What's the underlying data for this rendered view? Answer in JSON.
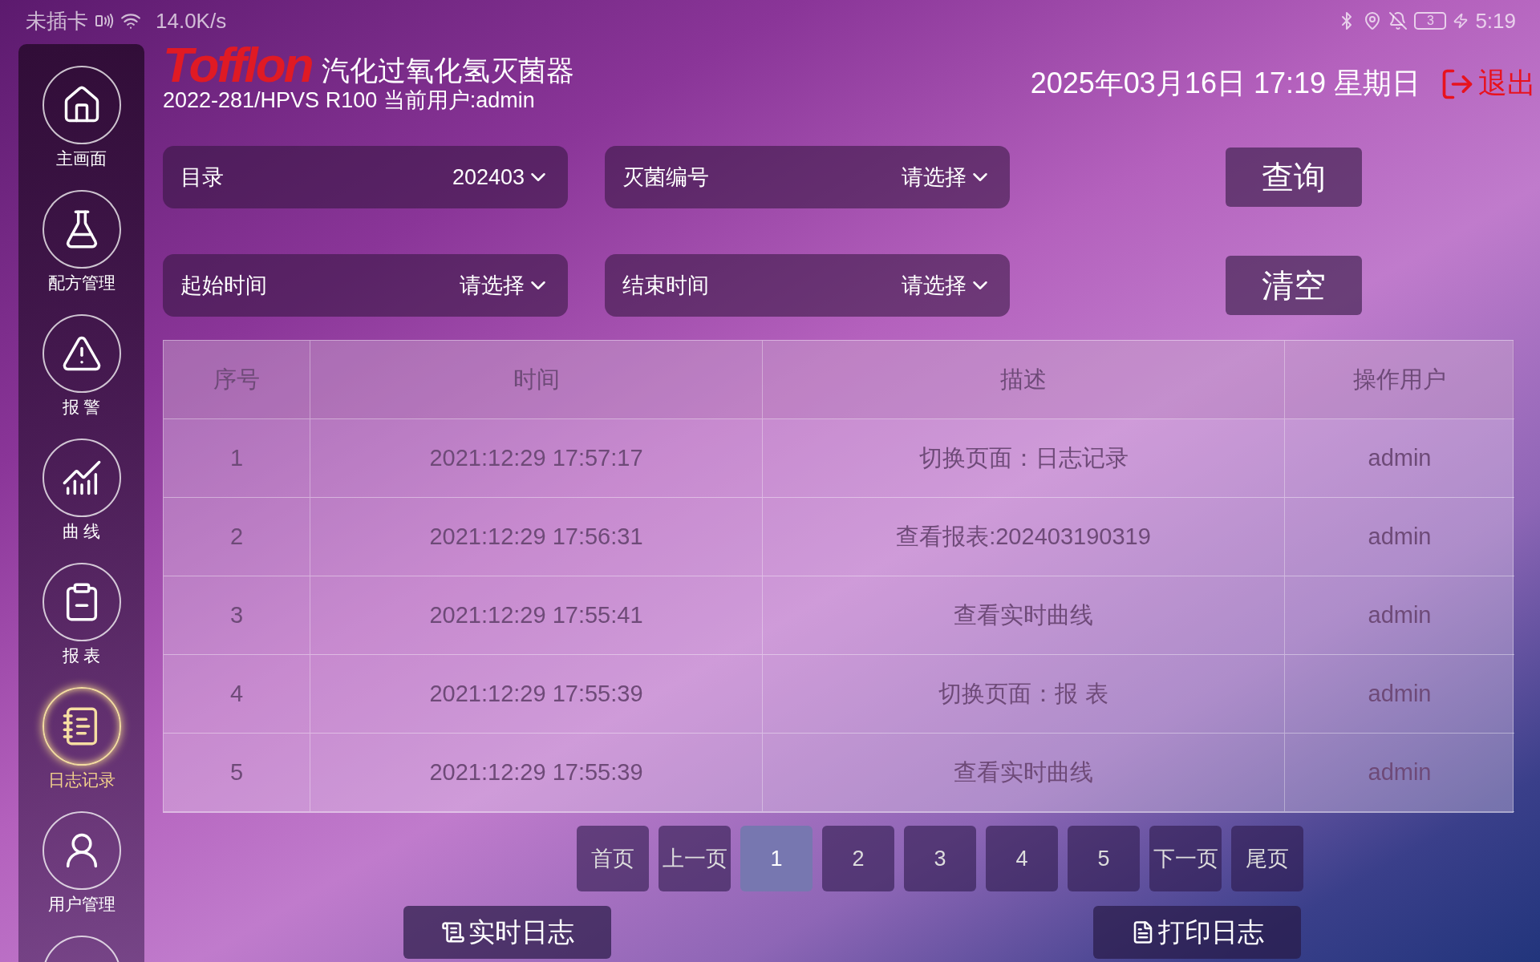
{
  "status_bar": {
    "carrier": "未插卡",
    "speed": "14.0K/s",
    "battery": "3",
    "time": "5:19"
  },
  "sidebar": {
    "items": [
      {
        "kind": "home",
        "label": "主画面",
        "selected": false
      },
      {
        "kind": "flask",
        "label": "配方管理",
        "selected": false
      },
      {
        "kind": "alert",
        "label": "报 警",
        "selected": false
      },
      {
        "kind": "chart",
        "label": "曲 线",
        "selected": false
      },
      {
        "kind": "report",
        "label": "报 表",
        "selected": false
      },
      {
        "kind": "log",
        "label": "日志记录",
        "selected": true
      },
      {
        "kind": "user",
        "label": "用户管理",
        "selected": false
      }
    ]
  },
  "header": {
    "logo": "Tofflon",
    "title": "汽化过氧化氢灭菌器",
    "subtitle": "2022-281/HPVS R100 当前用户:admin",
    "datetime": "2025年03月16日 17:19 星期日",
    "exit": "退出"
  },
  "filters": [
    {
      "label": "目录",
      "value": "202403"
    },
    {
      "label": "灭菌编号",
      "value": "请选择"
    },
    {
      "label": "起始时间",
      "value": "请选择"
    },
    {
      "label": "结束时间",
      "value": "请选择"
    }
  ],
  "actions": [
    "查询",
    "清空"
  ],
  "table": {
    "columns": [
      "序号",
      "时间",
      "描述",
      "操作用户"
    ],
    "rows": [
      [
        "1",
        "2021:12:29 17:57:17",
        "切换页面：日志记录",
        "admin"
      ],
      [
        "2",
        "2021:12:29 17:56:31",
        "查看报表:202403190319",
        "admin"
      ],
      [
        "3",
        "2021:12:29 17:55:41",
        "查看实时曲线",
        "admin"
      ],
      [
        "4",
        "2021:12:29 17:55:39",
        "切换页面：报 表",
        "admin"
      ],
      [
        "5",
        "2021:12:29 17:55:39",
        "查看实时曲线",
        "admin"
      ]
    ]
  },
  "pagination": [
    {
      "label": "首页",
      "selected": false
    },
    {
      "label": "上一页",
      "selected": false
    },
    {
      "label": "1",
      "selected": true
    },
    {
      "label": "2",
      "selected": false
    },
    {
      "label": "3",
      "selected": false
    },
    {
      "label": "4",
      "selected": false
    },
    {
      "label": "5",
      "selected": false
    },
    {
      "label": "下一页",
      "selected": false
    },
    {
      "label": "尾页",
      "selected": false
    }
  ],
  "bottom_buttons": [
    {
      "kind": "live",
      "label": "实时日志"
    },
    {
      "kind": "print",
      "label": "打印日志"
    }
  ]
}
